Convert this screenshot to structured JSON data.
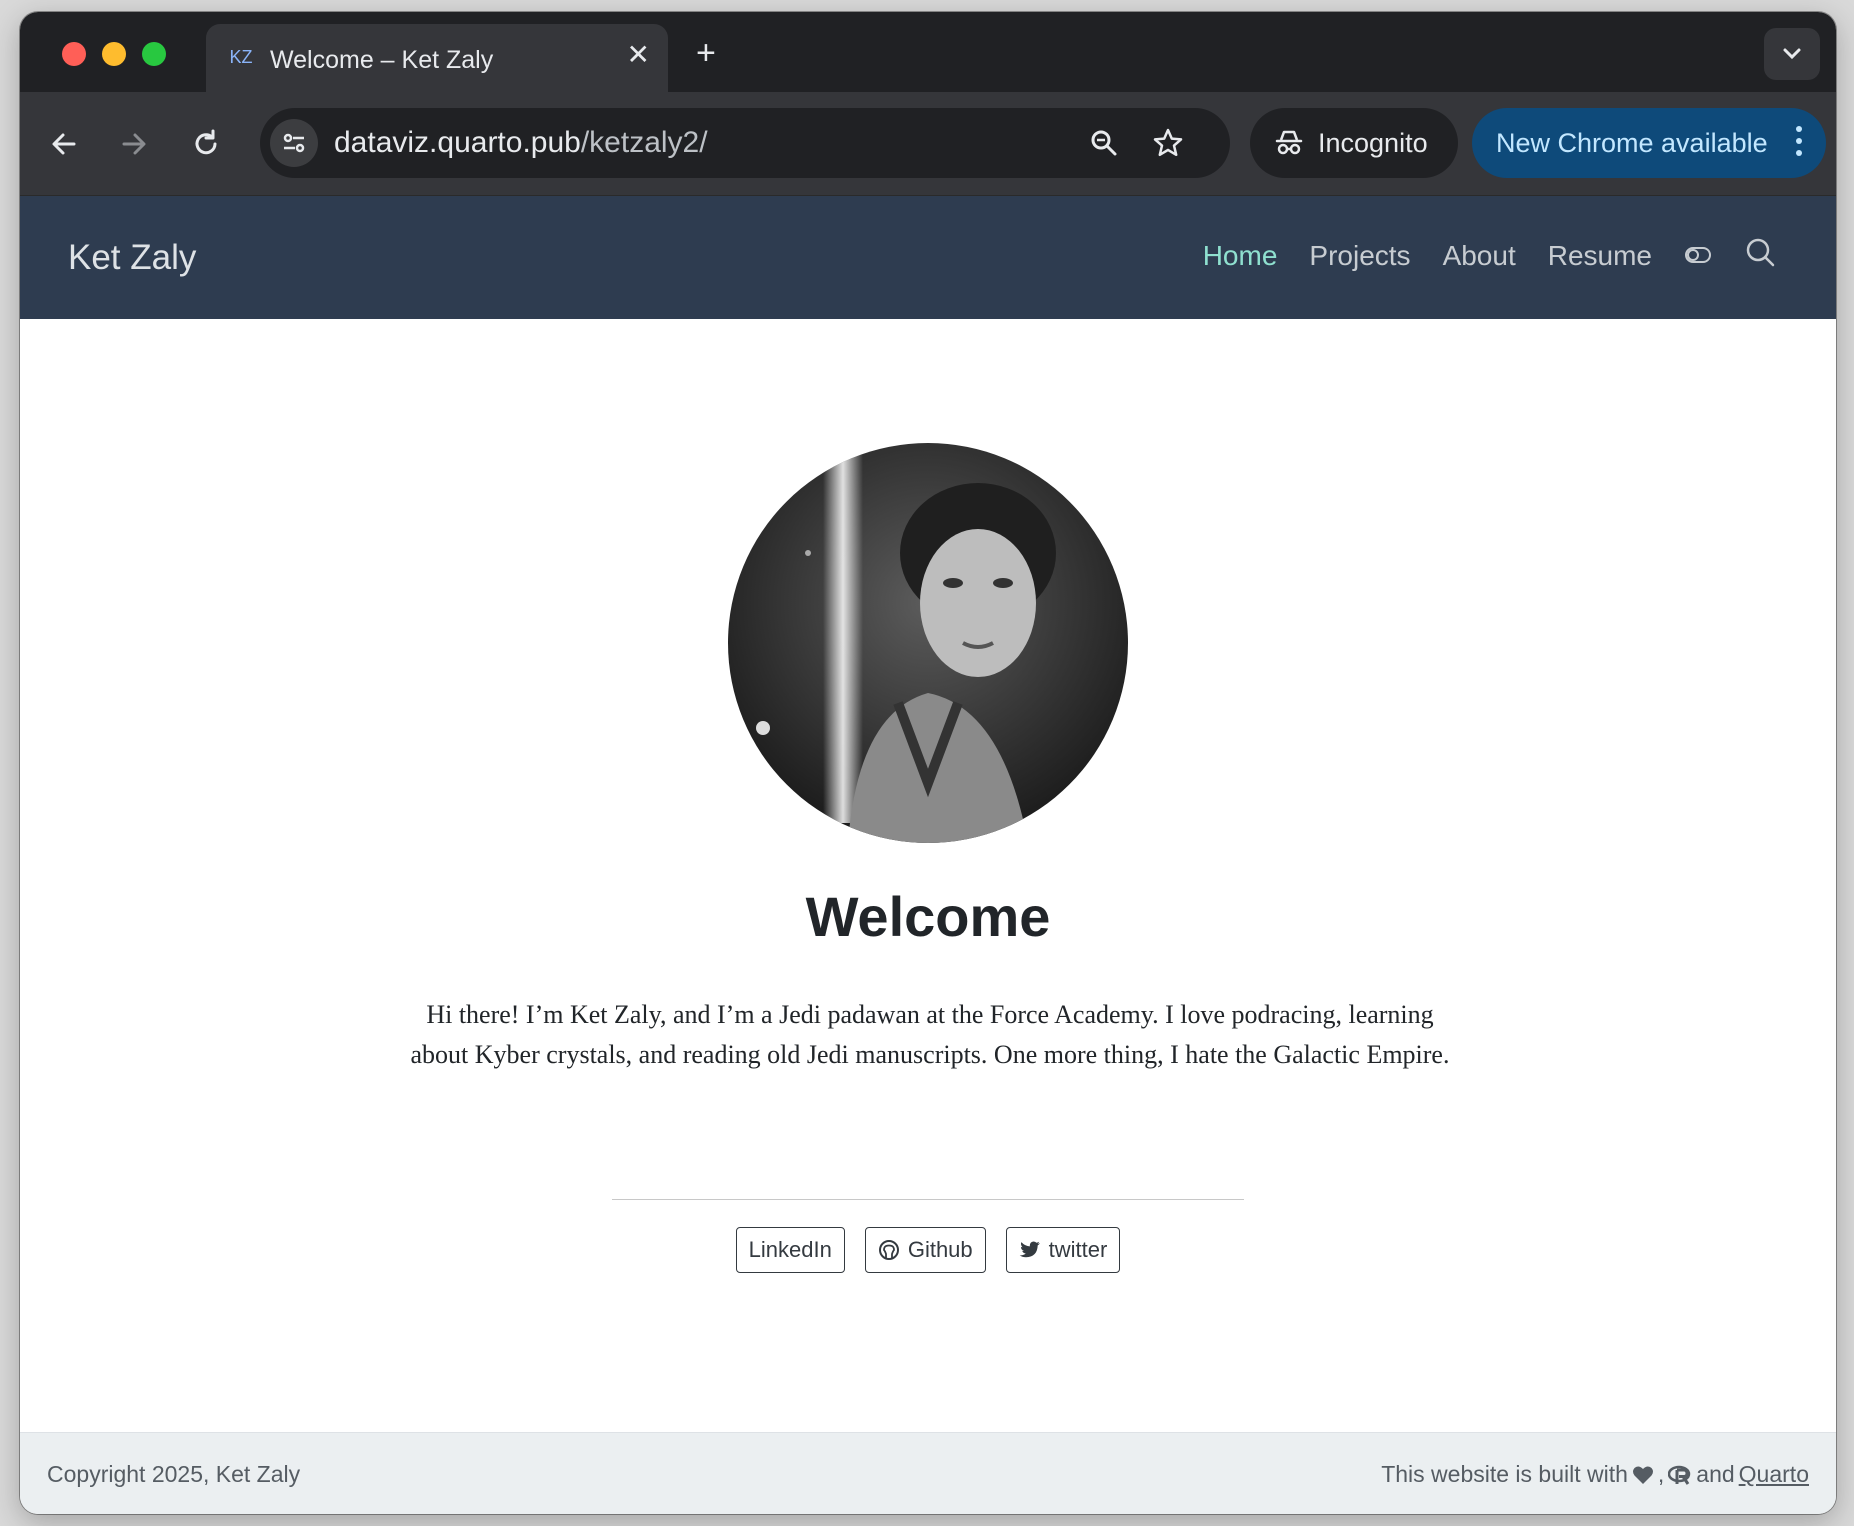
{
  "browser": {
    "tab": {
      "favicon": "KZ",
      "title": "Welcome – Ket Zaly"
    },
    "url": {
      "domain": "dataviz.quarto.pub",
      "path": "/ketzaly2/"
    },
    "incognito_label": "Incognito",
    "update_label": "New Chrome available"
  },
  "site": {
    "brand": "Ket Zaly",
    "nav": [
      {
        "label": "Home",
        "active": true
      },
      {
        "label": "Projects"
      },
      {
        "label": "About"
      },
      {
        "label": "Resume"
      }
    ]
  },
  "main": {
    "title": "Welcome",
    "bio": "Hi there! I’m Ket Zaly, and I’m a Jedi padawan at the Force Academy. I love podracing, learning about Kyber crystals, and reading old Jedi manuscripts. One more thing, I hate the Galactic Empire.",
    "socials": [
      {
        "label": "LinkedIn",
        "icon": ""
      },
      {
        "label": "Github",
        "icon": "github-icon"
      },
      {
        "label": "twitter",
        "icon": "twitter-icon"
      }
    ]
  },
  "footer": {
    "copyright": "Copyright 2025, Ket Zaly",
    "built_with": "This website is built with",
    "and": "and",
    "quarto": "Quarto"
  },
  "colors": {
    "navbar": "#2e3c50",
    "nav_active": "#8fe0cf",
    "chrome_update": "#0e4a7a"
  }
}
